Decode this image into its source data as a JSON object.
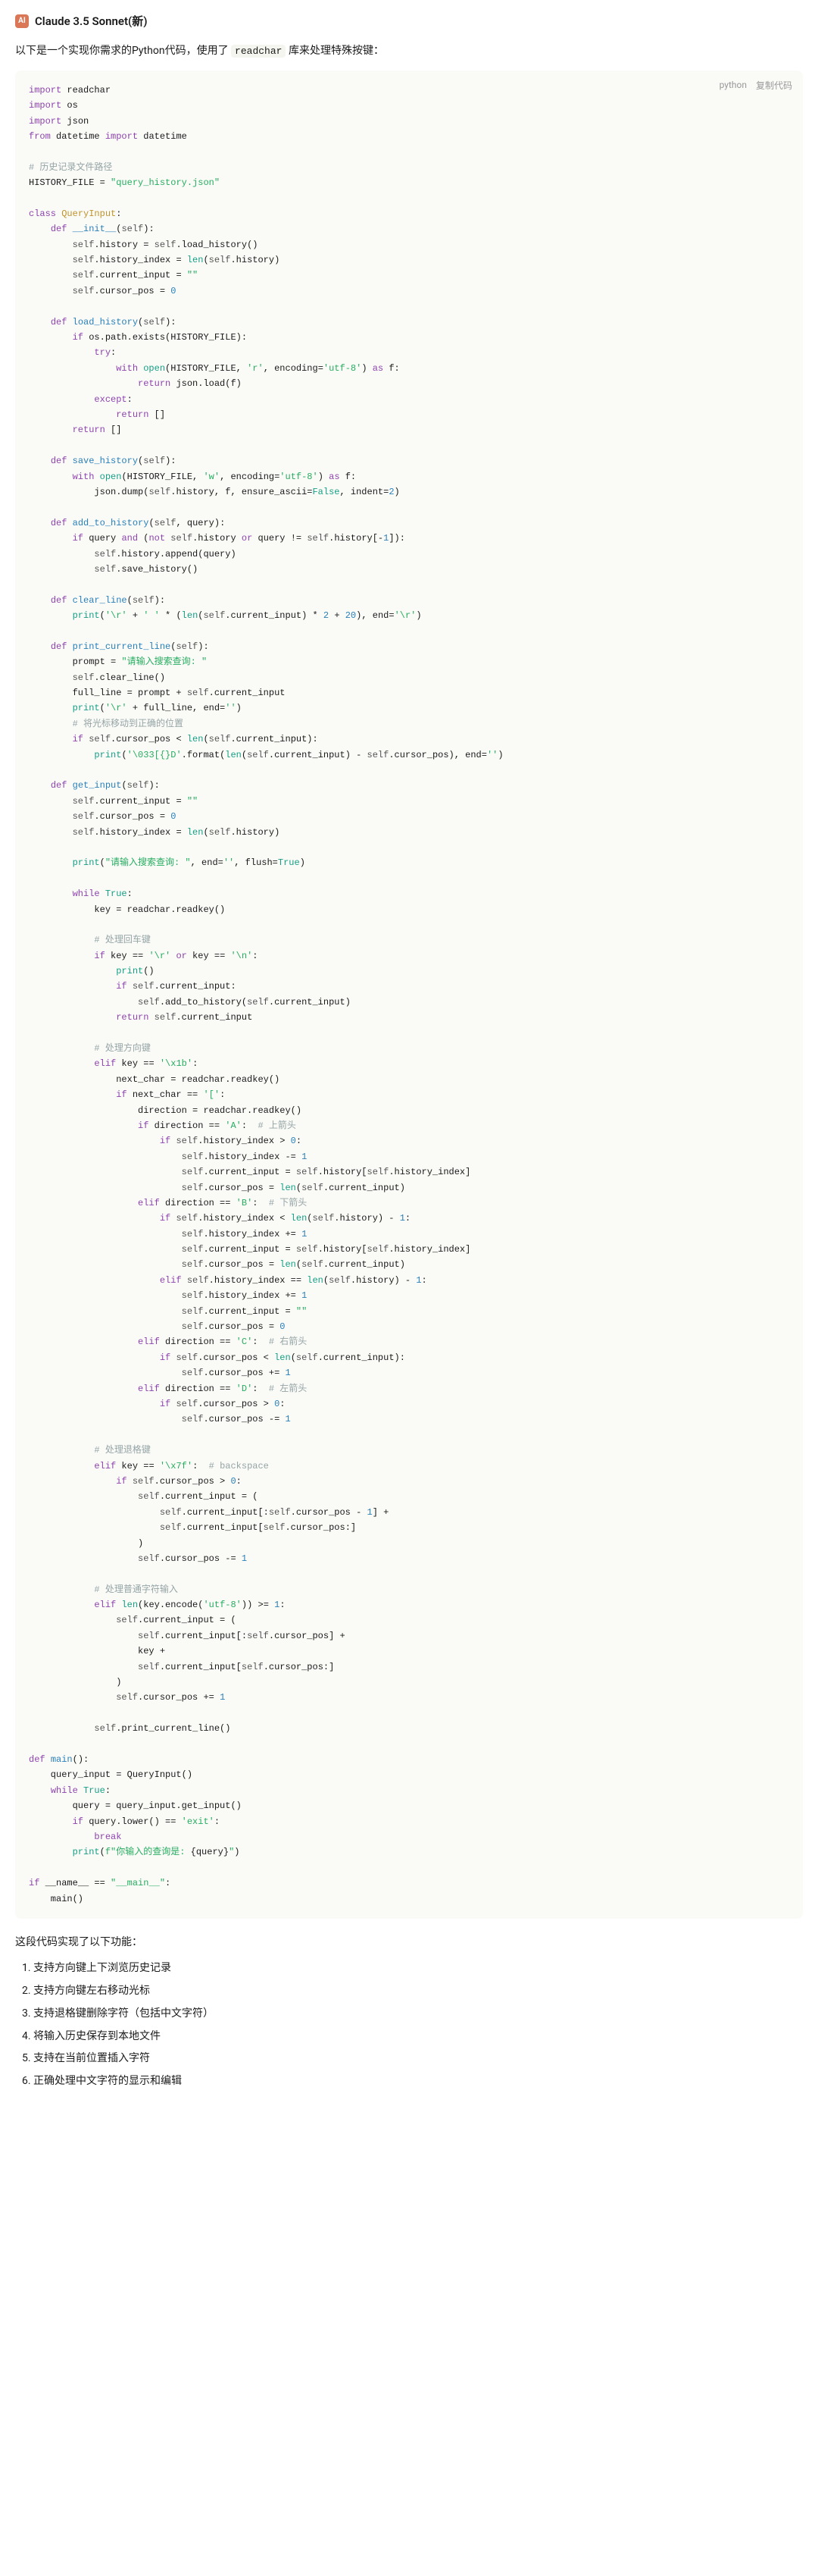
{
  "header": {
    "logo_text": "AI",
    "title": "Claude 3.5 Sonnet(新)"
  },
  "intro": {
    "prefix": "以下是一个实现你需求的Python代码，使用了 ",
    "lib": "readchar",
    "suffix": " 库来处理特殊按键："
  },
  "code": {
    "lang": "python",
    "copy": "复制代码"
  },
  "outro": "这段代码实现了以下功能：",
  "features": [
    "支持方向键上下浏览历史记录",
    "支持方向键左右移动光标",
    "支持退格键删除字符（包括中文字符）",
    "将输入历史保存到本地文件",
    "支持在当前位置插入字符",
    "正确处理中文字符的显示和编辑"
  ]
}
